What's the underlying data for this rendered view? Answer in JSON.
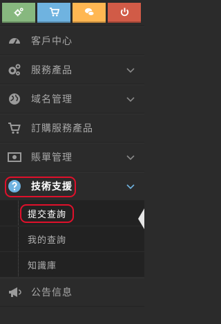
{
  "shortcuts": [
    {
      "name": "shortcut-settings",
      "icon": "cogs-icon",
      "color": "#87b87f"
    },
    {
      "name": "shortcut-cart",
      "icon": "cart-icon",
      "color": "#6fb3e0"
    },
    {
      "name": "shortcut-chat",
      "icon": "chat-icon",
      "color": "#ffb752"
    },
    {
      "name": "shortcut-power",
      "icon": "power-icon",
      "color": "#d15b47"
    }
  ],
  "nav": {
    "client_center": "客戶中心",
    "services": "服務產品",
    "domains": "域名管理",
    "order_services": "訂購服務產品",
    "billing": "賬單管理",
    "support": "技術支援",
    "announcements": "公告信息"
  },
  "support_submenu": {
    "submit_ticket": "提交查詢",
    "my_tickets": "我的查詢",
    "knowledgebase": "知識庫"
  },
  "colors": {
    "highlight": "#e0102b",
    "sidebar_bg": "#2b2b2b"
  }
}
